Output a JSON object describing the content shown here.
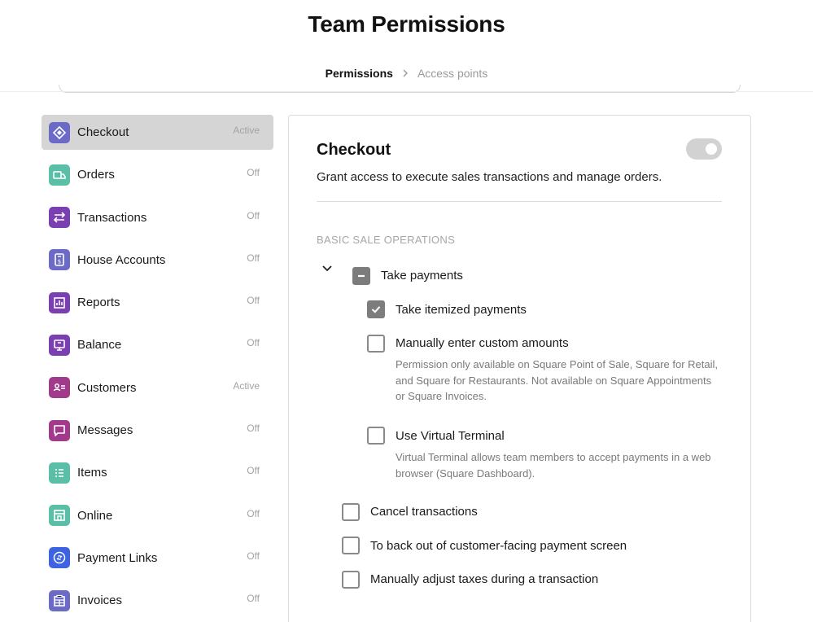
{
  "header": {
    "title": "Team Permissions",
    "breadcrumb": {
      "current": "Permissions",
      "next": "Access points"
    }
  },
  "sidebar": {
    "items": [
      {
        "label": "Checkout",
        "status": "Active",
        "icon": "checkout-icon",
        "color": "#6b6bc7"
      },
      {
        "label": "Orders",
        "status": "Off",
        "icon": "orders-icon",
        "color": "#5bbfa8"
      },
      {
        "label": "Transactions",
        "status": "Off",
        "icon": "transactions-icon",
        "color": "#7a3fb0"
      },
      {
        "label": "House Accounts",
        "status": "Off",
        "icon": "house-accounts-icon",
        "color": "#6b6bc7"
      },
      {
        "label": "Reports",
        "status": "Off",
        "icon": "reports-icon",
        "color": "#7a3fb0"
      },
      {
        "label": "Balance",
        "status": "Off",
        "icon": "balance-icon",
        "color": "#7a3fb0"
      },
      {
        "label": "Customers",
        "status": "Active",
        "icon": "customers-icon",
        "color": "#a23a8c"
      },
      {
        "label": "Messages",
        "status": "Off",
        "icon": "messages-icon",
        "color": "#a23a8c"
      },
      {
        "label": "Items",
        "status": "Off",
        "icon": "items-icon",
        "color": "#5bbfa8"
      },
      {
        "label": "Online",
        "status": "Off",
        "icon": "online-icon",
        "color": "#5bbfa8"
      },
      {
        "label": "Payment Links",
        "status": "Off",
        "icon": "payment-links-icon",
        "color": "#3d63e0"
      },
      {
        "label": "Invoices",
        "status": "Off",
        "icon": "invoices-icon",
        "color": "#6b6bc7"
      }
    ]
  },
  "panel": {
    "title": "Checkout",
    "description": "Grant access to execute sales transactions and manage orders.",
    "section_title": "BASIC SALE OPERATIONS",
    "take_payments": {
      "label": "Take payments",
      "state": "indeterminate"
    },
    "sub_permissions": [
      {
        "label": "Take itemized payments",
        "checked": true
      },
      {
        "label": "Manually enter custom amounts",
        "checked": false,
        "help": "Permission only available on Square Point of Sale, Square for Retail, and Square for Restaurants. Not available on Square Appointments or Square Invoices."
      },
      {
        "label": "Use Virtual Terminal",
        "checked": false,
        "help": "Virtual Terminal allows team members to accept payments in a web browser (Square Dashboard)."
      }
    ],
    "other_permissions": [
      {
        "label": "Cancel transactions",
        "checked": false
      },
      {
        "label": "To back out of customer-facing payment screen",
        "checked": false
      },
      {
        "label": "Manually adjust taxes during a transaction",
        "checked": false
      }
    ]
  },
  "colors": {
    "selected_bg": "#d5d5d5",
    "checkbox_filled": "#7c7c7c",
    "muted_text": "#a3a3a3"
  }
}
